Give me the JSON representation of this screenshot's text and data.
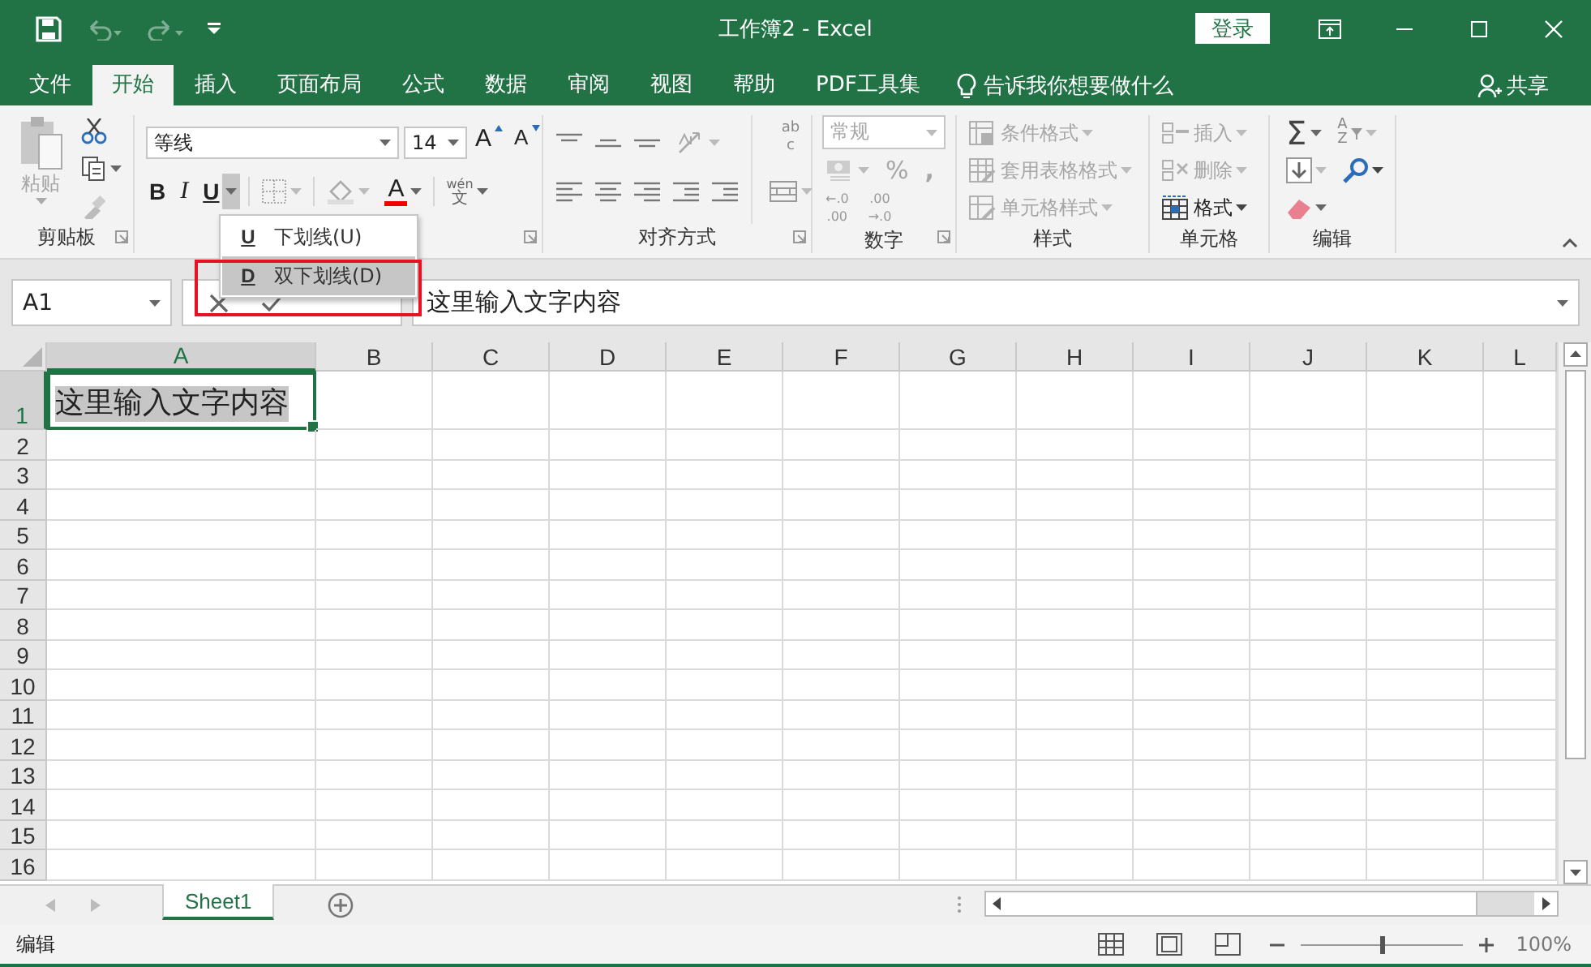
{
  "window": {
    "title": "工作簿2  -  Excel",
    "login_button": "登录"
  },
  "ribbon_tabs": [
    {
      "label": "文件",
      "selected": false
    },
    {
      "label": "开始",
      "selected": true
    },
    {
      "label": "插入",
      "selected": false
    },
    {
      "label": "页面布局",
      "selected": false
    },
    {
      "label": "公式",
      "selected": false
    },
    {
      "label": "数据",
      "selected": false
    },
    {
      "label": "审阅",
      "selected": false
    },
    {
      "label": "视图",
      "selected": false
    },
    {
      "label": "帮助",
      "selected": false
    },
    {
      "label": "PDF工具集",
      "selected": false
    }
  ],
  "tell_me": "告诉我你想要做什么",
  "share": "共享",
  "ribbon": {
    "clipboard": {
      "label": "剪贴板",
      "paste": "粘贴"
    },
    "font": {
      "font_name": "等线",
      "font_size": "14",
      "grow": "A",
      "shrink": "A",
      "bold": "B",
      "italic": "I",
      "underline": "U",
      "underline_menu_open": true,
      "font_color": "A",
      "phonetic_top": "wén",
      "phonetic_bottom": "文"
    },
    "alignment": {
      "label": "对齐方式",
      "wrap_top": "ab",
      "wrap_bottom": "c"
    },
    "number": {
      "label": "数字",
      "format": "常规",
      "percent": "%",
      "comma": ",",
      "increase_decimal": [
        "←.0",
        ".00"
      ],
      "decrease_decimal": [
        ".00",
        "→.0"
      ]
    },
    "styles": {
      "label": "样式",
      "items": [
        {
          "label": "条件格式",
          "disabled": true
        },
        {
          "label": "套用表格格式",
          "disabled": true
        },
        {
          "label": "单元格样式",
          "disabled": true
        }
      ]
    },
    "cells": {
      "label": "单元格",
      "items": [
        {
          "label": "插入",
          "disabled": true
        },
        {
          "label": "删除",
          "disabled": true
        },
        {
          "label": "格式",
          "disabled": false
        }
      ]
    },
    "editing": {
      "label": "编辑",
      "autosum": "Σ",
      "sort_top": "A",
      "sort_bottom": "Z"
    }
  },
  "underline_menu": {
    "items": [
      {
        "key": "U",
        "label": "下划线(U)",
        "selected": false
      },
      {
        "key": "D",
        "label": "双下划线(D)",
        "selected": true
      }
    ]
  },
  "formula_bar": {
    "name_box": "A1",
    "content": "这里输入文字内容"
  },
  "sheet": {
    "columns": [
      {
        "label": "A",
        "selected": true
      },
      {
        "label": "B",
        "selected": false
      },
      {
        "label": "C",
        "selected": false
      },
      {
        "label": "D",
        "selected": false
      },
      {
        "label": "E",
        "selected": false
      },
      {
        "label": "F",
        "selected": false
      },
      {
        "label": "G",
        "selected": false
      },
      {
        "label": "H",
        "selected": false
      },
      {
        "label": "I",
        "selected": false
      },
      {
        "label": "J",
        "selected": false
      },
      {
        "label": "K",
        "selected": false
      },
      {
        "label": "L",
        "selected": false
      }
    ],
    "rows": [
      {
        "label": "1",
        "selected": true,
        "cells": [
          "这里输入文字内容"
        ]
      },
      {
        "label": "2",
        "selected": false
      },
      {
        "label": "3",
        "selected": false
      },
      {
        "label": "4",
        "selected": false
      },
      {
        "label": "5",
        "selected": false
      },
      {
        "label": "6",
        "selected": false
      },
      {
        "label": "7",
        "selected": false
      },
      {
        "label": "8",
        "selected": false
      },
      {
        "label": "9",
        "selected": false
      },
      {
        "label": "10",
        "selected": false
      },
      {
        "label": "11",
        "selected": false
      },
      {
        "label": "12",
        "selected": false
      },
      {
        "label": "13",
        "selected": false
      },
      {
        "label": "14",
        "selected": false
      },
      {
        "label": "15",
        "selected": false
      },
      {
        "label": "16",
        "selected": false
      }
    ]
  },
  "sheet_tabs": [
    {
      "label": "Sheet1",
      "selected": true
    }
  ],
  "status_bar": {
    "mode": "编辑",
    "zoom": "100%",
    "zoom_level": {
      "level": 0.5
    }
  }
}
